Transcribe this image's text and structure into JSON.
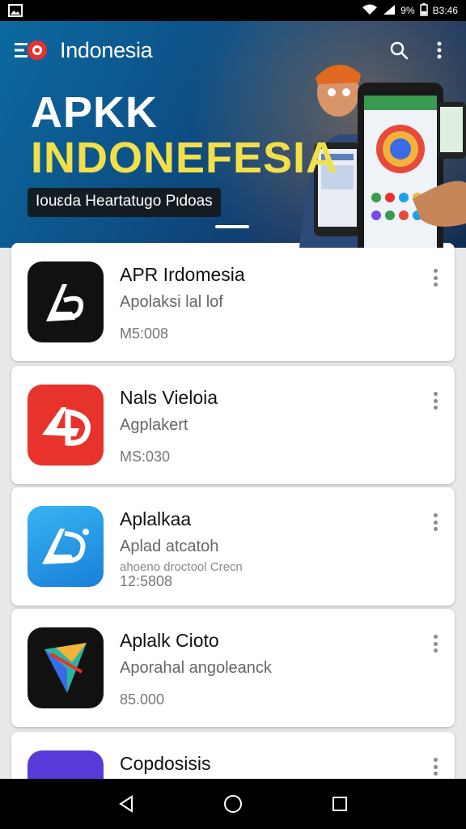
{
  "status_bar": {
    "battery_text": "9%",
    "time": "B3:46"
  },
  "header": {
    "title": "Indonesia"
  },
  "banner": {
    "line1": "APKK",
    "line2": "INDONEFESIA",
    "tagline": "Iouεda Heartatugo Pιdoas"
  },
  "apps": [
    {
      "name": "APR Irdomesia",
      "subtitle": "Apolaksi lal lof",
      "meta": "M5:008",
      "icon": "ap-logo-icon"
    },
    {
      "name": "Nals Vieloia",
      "subtitle": "Agplakert",
      "meta": "MS:030",
      "icon": "ad-logo-icon"
    },
    {
      "name": "Aplalkaa",
      "subtitle": "Aplad atcatoh",
      "meta_overlay": "ahoeno droctool Crecn",
      "meta": "12:5808",
      "icon": "ap-blue-logo-icon"
    },
    {
      "name": "Aplalk Cioto",
      "subtitle": "Aporahal angoleanck",
      "meta": "85.000",
      "icon": "prism-logo-icon"
    },
    {
      "name": "Copdosisis",
      "subtitle": "",
      "meta": "",
      "icon": "purple-app-icon"
    }
  ],
  "colors": {
    "hero_yellow": "#f2e04a",
    "accent_red": "#e8322c",
    "icon_blue": "#1e9fe8"
  }
}
